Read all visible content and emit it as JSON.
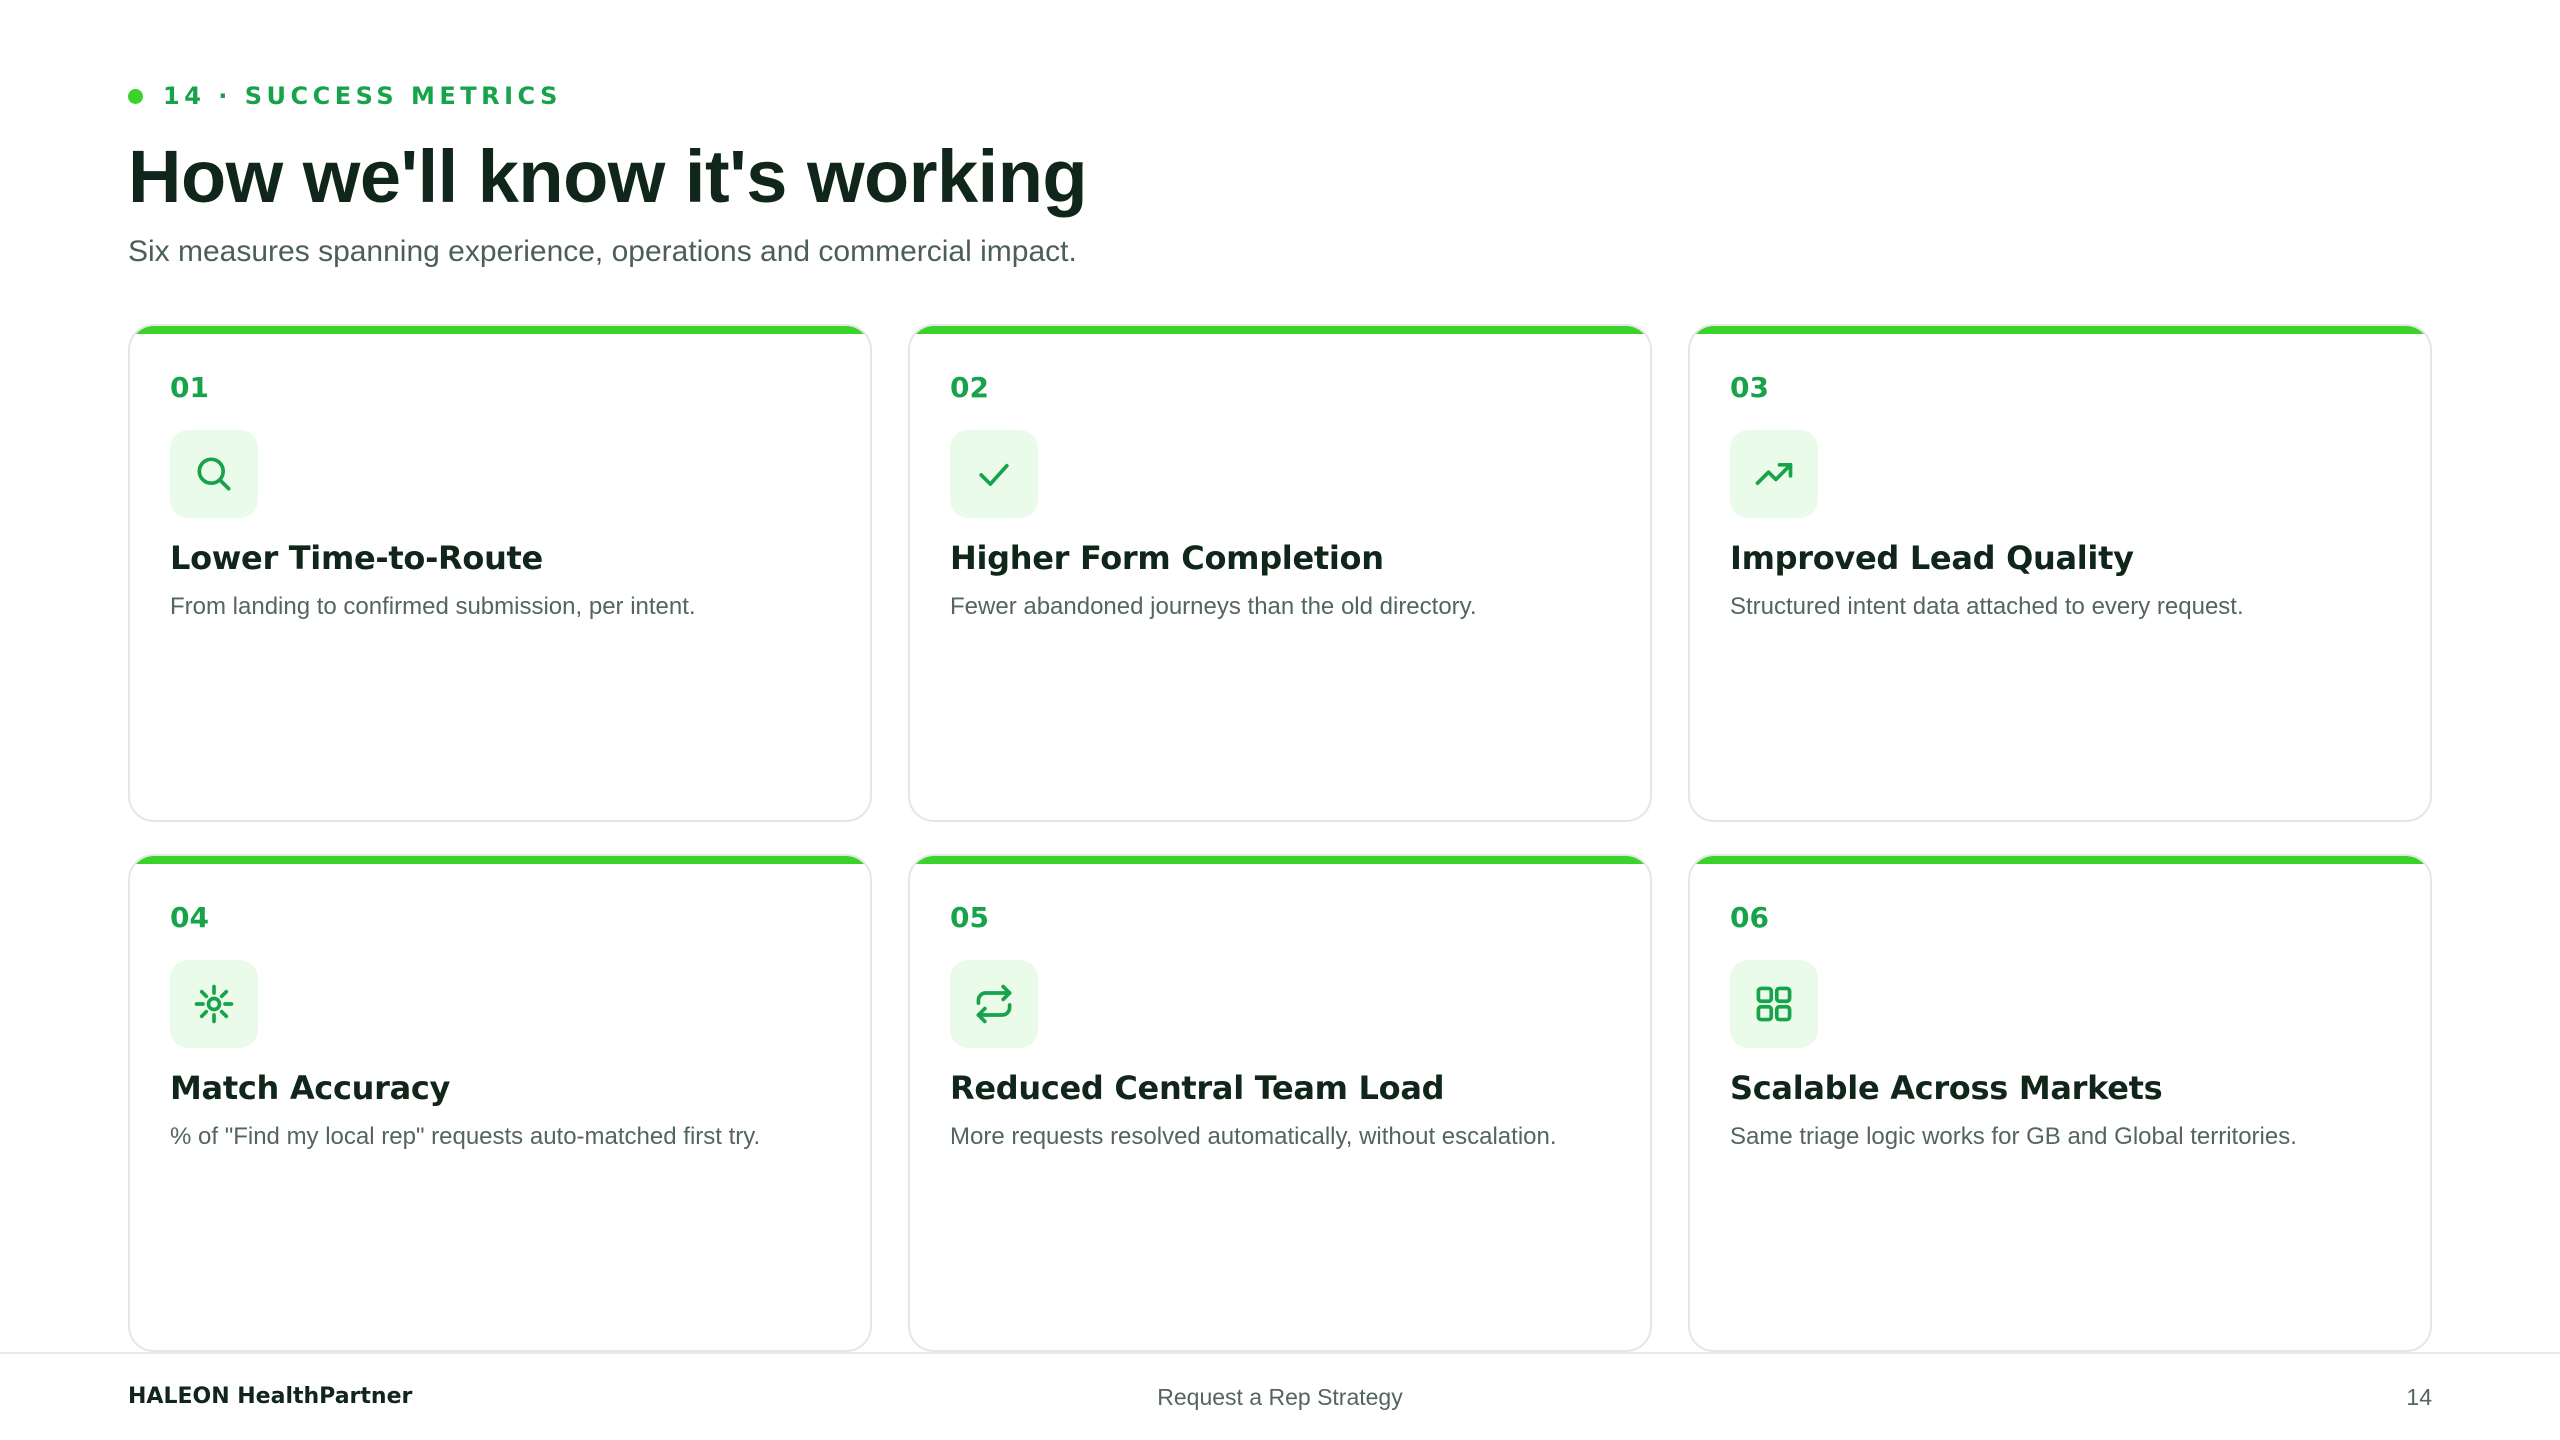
{
  "header": {
    "eyebrow": "14 · SUCCESS METRICS",
    "title": "How we'll know it's working",
    "subtitle": "Six measures spanning experience, operations and commercial impact."
  },
  "colors": {
    "accent": "#3bd32b",
    "accent_text": "#16a34a",
    "icon_bg": "#eafbea",
    "heading": "#10261a",
    "muted": "#54665c"
  },
  "metrics": [
    {
      "number": "01",
      "icon": "search-icon",
      "title": "Lower Time-to-Route",
      "description": "From landing to confirmed submission, per intent."
    },
    {
      "number": "02",
      "icon": "check-icon",
      "title": "Higher Form Completion",
      "description": "Fewer abandoned journeys than the old directory."
    },
    {
      "number": "03",
      "icon": "trending-up-icon",
      "title": "Improved Lead Quality",
      "description": "Structured intent data attached to every request."
    },
    {
      "number": "04",
      "icon": "sun-icon",
      "title": "Match Accuracy",
      "description": "% of \"Find my local rep\" requests auto-matched first try."
    },
    {
      "number": "05",
      "icon": "repeat-icon",
      "title": "Reduced Central Team Load",
      "description": "More requests resolved automatically, without escalation."
    },
    {
      "number": "06",
      "icon": "grid-icon",
      "title": "Scalable Across Markets",
      "description": "Same triage logic works for GB and Global territories."
    }
  ],
  "footer": {
    "brand": "HALEON HealthPartner",
    "center": "Request a Rep Strategy",
    "page": "14"
  }
}
